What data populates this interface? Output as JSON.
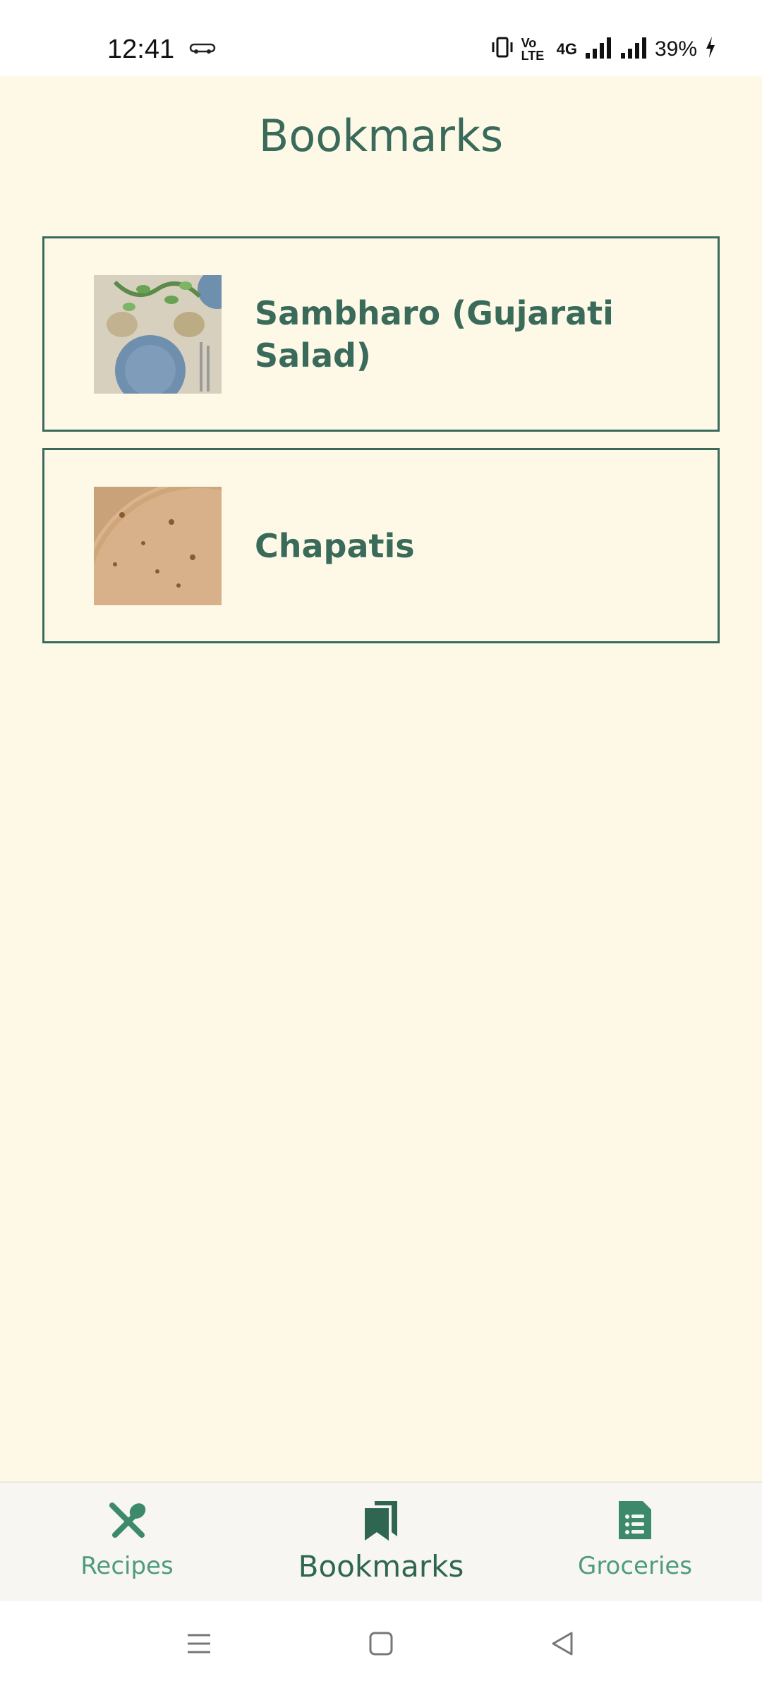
{
  "status_bar": {
    "time": "12:41",
    "volte": "Vo LTE",
    "network": "4G",
    "battery_percent": "39%",
    "icons": [
      "car-icon",
      "vibrate-icon",
      "volte-icon",
      "signal-4g-icon",
      "signal-icon",
      "charging-icon"
    ]
  },
  "header": {
    "title": "Bookmarks"
  },
  "bookmarks": [
    {
      "title": "Sambharo (Gujarati Salad)",
      "thumbnail": "table-setting-photo"
    },
    {
      "title": "Chapatis",
      "thumbnail": "chapatis-photo"
    }
  ],
  "bottom_nav": {
    "items": [
      {
        "label": "Recipes",
        "icon": "fork-spoon-icon",
        "active": false
      },
      {
        "label": "Bookmarks",
        "icon": "bookmarks-icon",
        "active": true
      },
      {
        "label": "Groceries",
        "icon": "list-icon",
        "active": false
      }
    ]
  },
  "colors": {
    "accent": "#3a6a5a",
    "background": "#fef9e7",
    "nav_inactive": "#4e9b80"
  },
  "system_nav": {
    "icons": [
      "menu-icon",
      "home-icon",
      "back-icon"
    ]
  }
}
